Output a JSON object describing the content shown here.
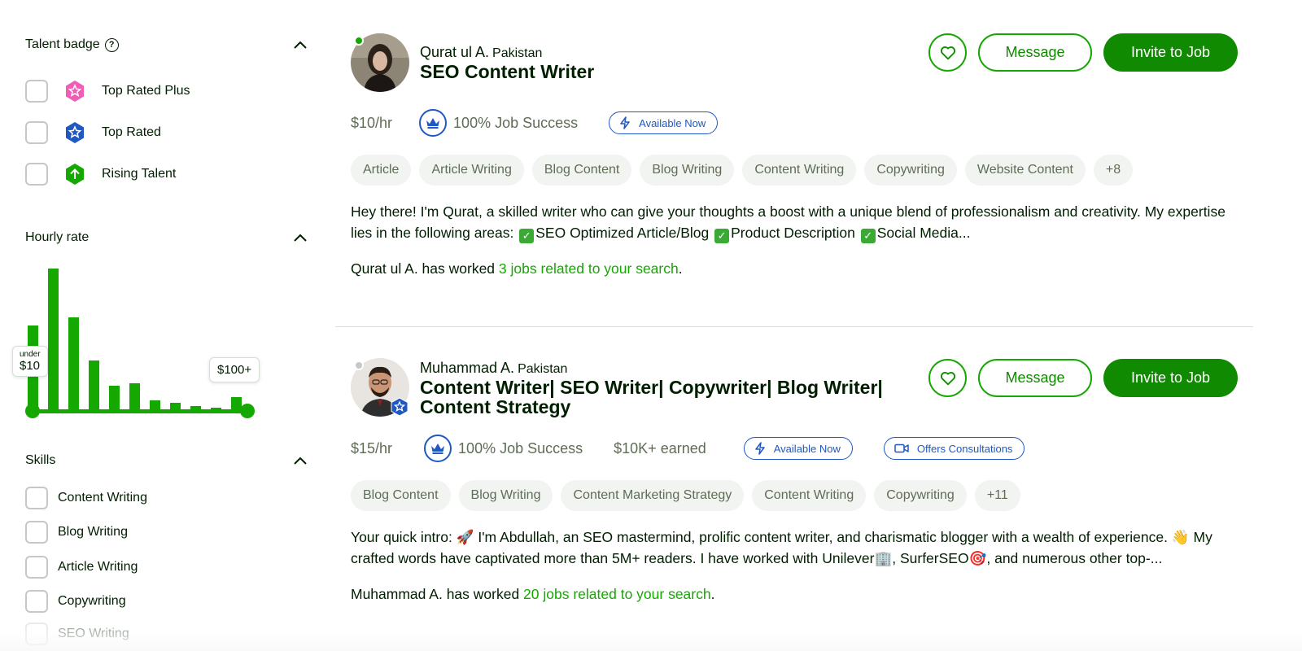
{
  "filters": {
    "talent_badge": {
      "title": "Talent badge",
      "options": [
        {
          "label": "Top Rated Plus",
          "color": "#f05cb6"
        },
        {
          "label": "Top Rated",
          "color": "#1f57c3"
        },
        {
          "label": "Rising Talent",
          "color": "#14a800"
        }
      ]
    },
    "hourly_rate": {
      "title": "Hourly rate",
      "min_sub": "under",
      "min_label": "$10",
      "max_label": "$100+",
      "histogram": [
        0.6,
        1.0,
        0.66,
        0.36,
        0.18,
        0.2,
        0.08,
        0.06,
        0.04,
        0.03,
        0.1
      ],
      "selected_min_fraction": 0,
      "selected_max_fraction": 1
    },
    "skills": {
      "title": "Skills",
      "options": [
        "Content Writing",
        "Blog Writing",
        "Article Writing",
        "Copywriting",
        "SEO Writing"
      ]
    }
  },
  "freelancers": [
    {
      "name": "Qurat ul A.",
      "country": "Pakistan",
      "title": "SEO Content Writer",
      "online": true,
      "rate": "$10/hr",
      "job_success": "100% Job Success",
      "earned": "",
      "badges": [
        "Available Now"
      ],
      "skills": [
        "Article",
        "Article Writing",
        "Blog Content",
        "Blog Writing",
        "Content Writing",
        "Copywriting",
        "Website Content",
        "+8"
      ],
      "description_parts": [
        "Hey there! I'm Qurat, a skilled writer who can give your thoughts a boost with a unique blend of professionalism and creativity. My expertise lies in the following areas: ",
        "SEO Optimized Article/Blog ",
        "Product Description ",
        "Social Media..."
      ],
      "jobs_prefix": "Qurat ul A. has worked ",
      "jobs_link": "3 jobs related to your search",
      "jobs_suffix": ".",
      "message_label": "Message",
      "invite_label": "Invite to Job"
    },
    {
      "name": "Muhammad A.",
      "country": "Pakistan",
      "title": "Content Writer| SEO Writer| Copywriter| Blog Writer| Content Strategy",
      "online": false,
      "avatar_badge": "top-rated-badge-icon",
      "rate": "$15/hr",
      "job_success": "100% Job Success",
      "earned": "$10K+ earned",
      "badges": [
        "Available Now",
        "Offers Consultations"
      ],
      "skills": [
        "Blog Content",
        "Blog Writing",
        "Content Marketing Strategy",
        "Content Writing",
        "Copywriting",
        "+11"
      ],
      "description": "Your quick intro: 🚀 I'm Abdullah, an SEO mastermind, prolific content writer, and charismatic blogger with a wealth of experience. 👋 My crafted words have captivated more than 5M+ readers. I have worked with Unilever🏢, SurferSEO🎯, and numerous other top-...",
      "jobs_prefix": "Muhammad A. has worked ",
      "jobs_link": "20 jobs related to your search",
      "jobs_suffix": ".",
      "message_label": "Message",
      "invite_label": "Invite to Job"
    }
  ],
  "colors": {
    "brand_green": "#14a800",
    "button_green": "#108a00",
    "badge_blue": "#1f57c3",
    "muted_text": "#5e6d55",
    "tag_bg": "#f2f4f1"
  }
}
